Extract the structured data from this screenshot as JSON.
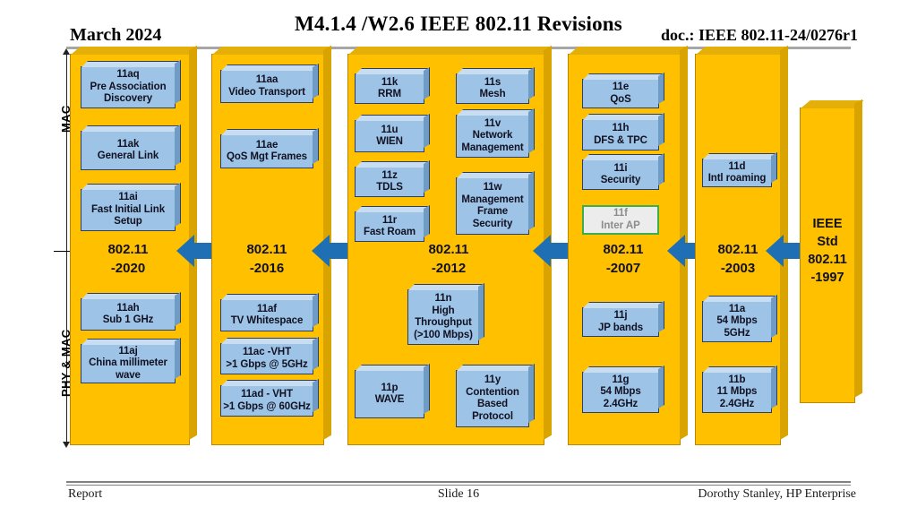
{
  "header": {
    "date": "March 2024",
    "title": "M4.1.4 /W2.6 IEEE 802.11 Revisions",
    "doc": "doc.: IEEE 802.11-24/0276r1"
  },
  "footer": {
    "left": "Report",
    "center": "Slide 16",
    "right": "Dorothy Stanley, HP Enterprise"
  },
  "side_labels": {
    "mac": "MAC",
    "phy_mac": "PHY & MAC"
  },
  "colors": {
    "pillar": "#FFC000",
    "pillar_side": "#D9A400",
    "box": "#9DC3E6",
    "box_border": "#2C3E66",
    "arrow": "#1F6FB5",
    "withdrawn_border": "#3FAE49",
    "withdrawn_text": "#8C8C8C"
  },
  "columns": [
    {
      "id": "col-802-11-2020",
      "standard": "802.11\n-2020",
      "boxes": [
        {
          "id": "11aq",
          "text": "11aq\nPre Association\nDiscovery",
          "style": "blue"
        },
        {
          "id": "11ak",
          "text": "11ak\nGeneral Link",
          "style": "blue"
        },
        {
          "id": "11ai",
          "text": "11ai\nFast Initial Link\nSetup",
          "style": "blue"
        },
        {
          "id": "11ah",
          "text": "11ah\nSub 1 GHz",
          "style": "blue"
        },
        {
          "id": "11aj",
          "text": "11aj\nChina millimeter\nwave",
          "style": "blue"
        }
      ]
    },
    {
      "id": "col-802-11-2016",
      "standard": "802.11\n-2016",
      "boxes": [
        {
          "id": "11aa",
          "text": "11aa\nVideo Transport",
          "style": "blue"
        },
        {
          "id": "11ae",
          "text": "11ae\nQoS Mgt Frames",
          "style": "blue"
        },
        {
          "id": "11af",
          "text": "11af\nTV Whitespace",
          "style": "blue"
        },
        {
          "id": "11ac",
          "text": "11ac -VHT\n>1 Gbps @ 5GHz",
          "style": "blue"
        },
        {
          "id": "11ad",
          "text": "11ad - VHT\n>1 Gbps @ 60GHz",
          "style": "blue"
        }
      ]
    },
    {
      "id": "col-802-11-2012",
      "standard": "802.11\n-2012",
      "boxes": [
        {
          "id": "11k",
          "text": "11k\nRRM",
          "style": "blue"
        },
        {
          "id": "11u",
          "text": "11u\nWIEN",
          "style": "blue"
        },
        {
          "id": "11z",
          "text": "11z\nTDLS",
          "style": "blue"
        },
        {
          "id": "11r",
          "text": "11r\nFast Roam",
          "style": "blue"
        },
        {
          "id": "11s",
          "text": "11s\nMesh",
          "style": "blue"
        },
        {
          "id": "11v",
          "text": "11v\nNetwork\nManagement",
          "style": "blue"
        },
        {
          "id": "11w",
          "text": "11w\nManagement\nFrame\nSecurity",
          "style": "blue"
        },
        {
          "id": "11n",
          "text": "11n\nHigh\nThroughput\n(>100 Mbps)",
          "style": "blue"
        },
        {
          "id": "11p",
          "text": "11p\nWAVE",
          "style": "blue"
        },
        {
          "id": "11y",
          "text": "11y\nContention\nBased\nProtocol",
          "style": "blue"
        }
      ]
    },
    {
      "id": "col-802-11-2007",
      "standard": "802.11\n-2007",
      "boxes": [
        {
          "id": "11e",
          "text": "11e\nQoS",
          "style": "blue"
        },
        {
          "id": "11h",
          "text": "11h\nDFS & TPC",
          "style": "blue"
        },
        {
          "id": "11i",
          "text": "11i\nSecurity",
          "style": "blue"
        },
        {
          "id": "11f",
          "text": "11f\nInter AP",
          "style": "withdrawn"
        },
        {
          "id": "11j",
          "text": "11j\nJP bands",
          "style": "blue"
        },
        {
          "id": "11g",
          "text": "11g\n54 Mbps\n2.4GHz",
          "style": "blue"
        }
      ]
    },
    {
      "id": "col-802-11-2003",
      "standard": "802.11\n-2003",
      "boxes": [
        {
          "id": "11d",
          "text": "11d\nIntl roaming",
          "style": "blue"
        },
        {
          "id": "11a",
          "text": "11a\n54 Mbps\n5GHz",
          "style": "blue"
        },
        {
          "id": "11b",
          "text": "11b\n11 Mbps\n2.4GHz",
          "style": "blue"
        }
      ]
    },
    {
      "id": "col-802-11-1997",
      "standard": "IEEE\nStd\n802.11\n-1997",
      "boxes": []
    }
  ],
  "arrows": [
    {
      "id": "arrow-2016-to-2020",
      "direction": "left"
    },
    {
      "id": "arrow-2012-to-2016",
      "direction": "left"
    },
    {
      "id": "arrow-2007-to-2012",
      "direction": "left"
    },
    {
      "id": "arrow-2003-to-2007",
      "direction": "left"
    },
    {
      "id": "arrow-1997-to-2003",
      "direction": "left"
    }
  ]
}
